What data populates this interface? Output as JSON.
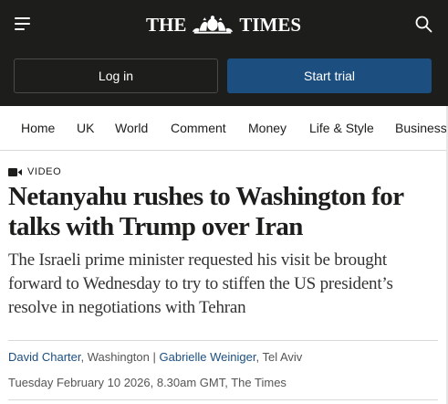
{
  "header": {
    "brand_left": "THE",
    "brand_right": "TIMES",
    "icons": {
      "menu": "hamburger-menu-icon",
      "crest": "royal-crest-icon",
      "search": "search-icon"
    },
    "background": "#1d1d1b"
  },
  "auth": {
    "login_label": "Log in",
    "trial_label": "Start trial",
    "trial_color": "#1c4f80"
  },
  "nav": {
    "items": [
      "Home",
      "UK",
      "World",
      "Comment",
      "Money",
      "Life & Style",
      "Business"
    ]
  },
  "article": {
    "tag_icon": "video-camera-icon",
    "tag": "VIDEO",
    "headline": "Netanyahu rushes to Washington for talks with Trump over Iran",
    "standfirst": "The Israeli prime minister requested his visit be brought forward to Wednesday to try to stiffen the US president’s resolve in negotiations with Tehran",
    "authors": [
      {
        "name": "David Charter",
        "location": ", Washington"
      },
      {
        "name": "Gabrielle Weiniger",
        "location": ", Tel Aviv"
      }
    ],
    "author_separator": " | ",
    "date": "Tuesday February 10 2026, 8.30am GMT, The Times",
    "link_color": "#1c4f80"
  }
}
